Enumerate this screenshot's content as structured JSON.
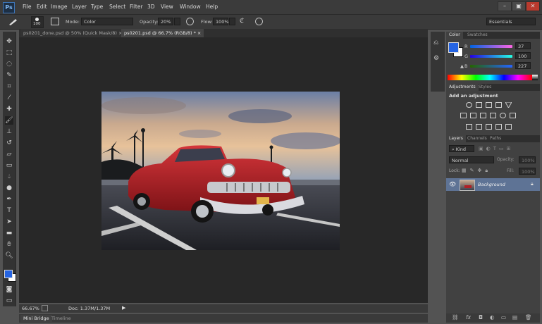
{
  "app": {
    "logo": "Ps",
    "menus": [
      "File",
      "Edit",
      "Image",
      "Layer",
      "Type",
      "Select",
      "Filter",
      "3D",
      "View",
      "Window",
      "Help"
    ],
    "window_buttons": [
      "–",
      "▣",
      "✕"
    ]
  },
  "options": {
    "mode_label": "Mode:",
    "mode_value": "Color",
    "opacity_label": "Opacity:",
    "opacity_value": "20%",
    "flow_label": "Flow:",
    "flow_value": "100%",
    "brush_size": "100",
    "workspace": "Essentials"
  },
  "documents": {
    "tabs": [
      "ps0201_done.psd @ 50% (Quick Mask/8)",
      "ps0201.psd @ 66.7% (RGB/8) *"
    ]
  },
  "status": {
    "zoom": "66.67%",
    "doc": "Doc: 1.37M/1.37M"
  },
  "bottom_tabs": [
    "Mini Bridge",
    "Timeline"
  ],
  "color_panel": {
    "tabs": [
      "Color",
      "Swatches"
    ],
    "channels": [
      {
        "label": "R",
        "value": "37"
      },
      {
        "label": "G",
        "value": "100"
      },
      {
        "label": "B",
        "value": "227"
      }
    ],
    "foreground": "#2564e3",
    "background": "#ffffff"
  },
  "adjustments": {
    "tabs": [
      "Adjustments",
      "Styles"
    ],
    "heading": "Add an adjustment"
  },
  "layers": {
    "tabs": [
      "Layers",
      "Channels",
      "Paths"
    ],
    "kind_label": "Kind",
    "blend_mode": "Normal",
    "opacity_label": "Opacity:",
    "opacity_value": "100%",
    "lock_label": "Lock:",
    "fill_label": "Fill:",
    "fill_value": "100%",
    "layer_name": "Background"
  },
  "tools": [
    "move",
    "marquee",
    "lasso",
    "quick-select",
    "crop",
    "eyedropper",
    "healing",
    "brush",
    "clone-stamp",
    "history-brush",
    "eraser",
    "gradient",
    "blur",
    "dodge",
    "pen",
    "type",
    "path-select",
    "rectangle",
    "hand",
    "zoom"
  ]
}
